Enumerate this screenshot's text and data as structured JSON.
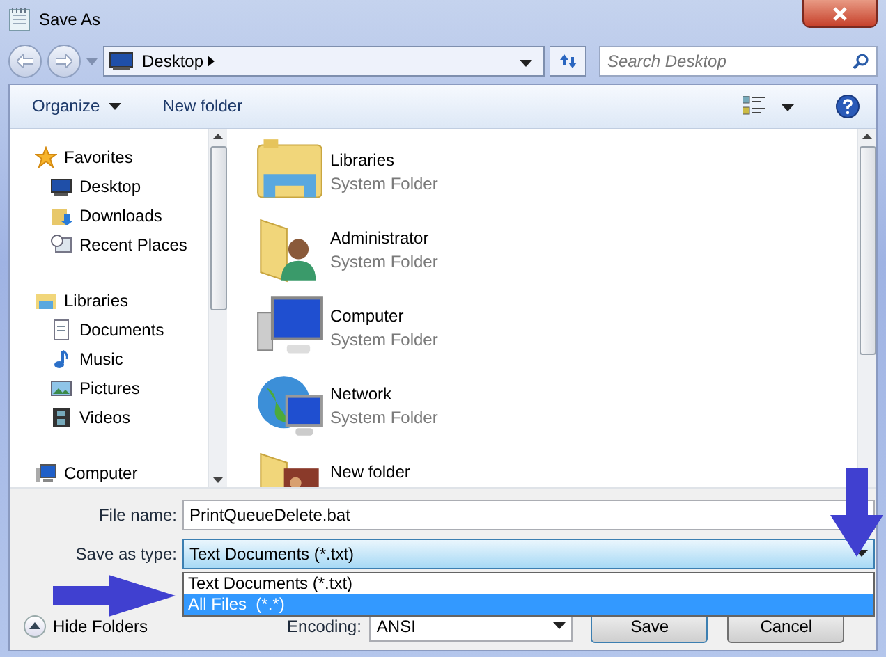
{
  "window": {
    "title": "Save As"
  },
  "address": {
    "location": "Desktop"
  },
  "search": {
    "placeholder": "Search Desktop"
  },
  "toolbar": {
    "organize": "Organize",
    "new_folder": "New folder"
  },
  "nav": [
    {
      "label": "Favorites",
      "kind": "star",
      "children": [
        {
          "label": "Desktop",
          "kind": "desktop"
        },
        {
          "label": "Downloads",
          "kind": "downloads"
        },
        {
          "label": "Recent Places",
          "kind": "recent"
        }
      ]
    },
    {
      "label": "Libraries",
      "kind": "libraries",
      "children": [
        {
          "label": "Documents",
          "kind": "documents"
        },
        {
          "label": "Music",
          "kind": "music"
        },
        {
          "label": "Pictures",
          "kind": "pictures"
        },
        {
          "label": "Videos",
          "kind": "videos"
        }
      ]
    },
    {
      "label": "Computer",
      "kind": "computer"
    }
  ],
  "files": [
    {
      "name": "Libraries",
      "type": "System Folder",
      "kind": "libraries"
    },
    {
      "name": "Administrator",
      "type": "System Folder",
      "kind": "user"
    },
    {
      "name": "Computer",
      "type": "System Folder",
      "kind": "computer"
    },
    {
      "name": "Network",
      "type": "System Folder",
      "kind": "network"
    },
    {
      "name": "New folder",
      "kind": "folder"
    }
  ],
  "form": {
    "file_name_label": "File name:",
    "file_name": "PrintQueueDelete.bat",
    "type_label": "Save as type:",
    "type": "Text Documents (*.txt)",
    "type_options": [
      {
        "label": "Text Documents (*.txt)",
        "selected": false
      },
      {
        "label": "All Files  (*.*)",
        "selected": true
      }
    ],
    "hide_folders": "Hide Folders",
    "encoding_label": "Encoding:",
    "encoding": "ANSI",
    "save": "Save",
    "cancel": "Cancel"
  }
}
